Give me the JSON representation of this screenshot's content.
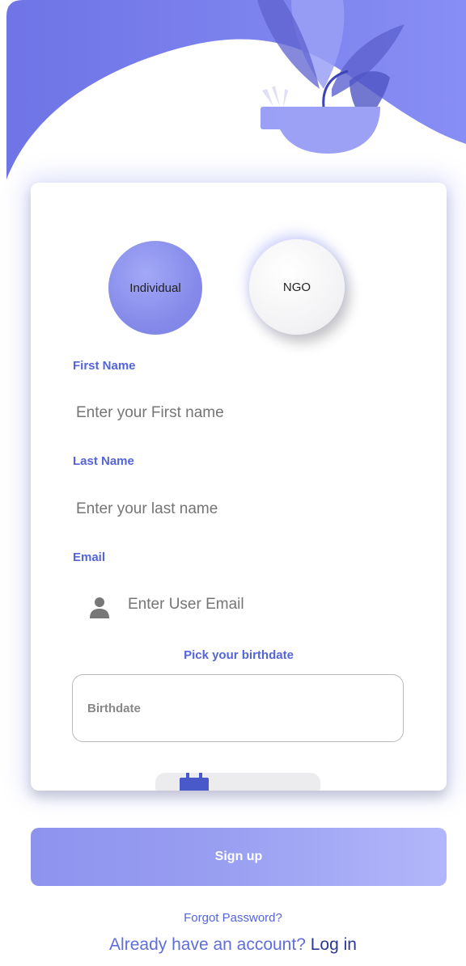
{
  "user_type": {
    "individual_label": "Individual",
    "ngo_label": "NGO",
    "selected": "Individual"
  },
  "form": {
    "first_name": {
      "label": "First Name",
      "placeholder": "Enter your First name"
    },
    "last_name": {
      "label": "Last Name",
      "placeholder": "Enter your last name"
    },
    "email": {
      "label": "Email",
      "placeholder": "Enter User Email",
      "icon": "user-icon"
    },
    "birthdate": {
      "label": "Pick your birthdate",
      "placeholder": "Birthdate",
      "icon": "calendar-icon"
    }
  },
  "actions": {
    "signup_label": "Sign up",
    "forgot_password": "Forgot Password?",
    "already_have_account": "Already have an account?",
    "login_label": "Log in"
  },
  "colors": {
    "accent": "#5464d9",
    "header_wave": "#7f86f0",
    "selected_type": "#868bea",
    "signup_gradient_start": "#8e93ee",
    "signup_gradient_end": "#b2b7fa"
  }
}
